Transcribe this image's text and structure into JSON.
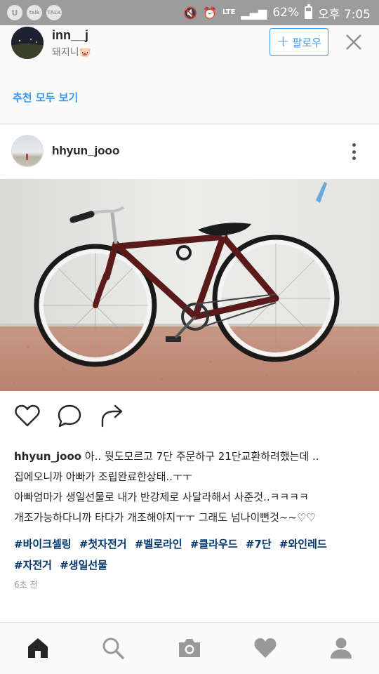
{
  "status_bar": {
    "app_icons": [
      "U",
      "talk",
      "TALK"
    ],
    "network": "LTE",
    "battery_text": "62%",
    "battery_level": 0.62,
    "time": "오후 7:05"
  },
  "suggestion": {
    "username": "inn__j",
    "subtitle": "돼지니🐷",
    "follow_label": "팔로우",
    "see_all_label": "추천 모두 보기"
  },
  "post": {
    "username": "hhyun_jooo",
    "caption": {
      "username": "hhyun_jooo",
      "line1": " 아.. 뭣도모르고 7단 주문하구 21단교환하려했는데 ..",
      "line2": "집에오니까 아빠가 조립완료한상태..ㅜㅜ",
      "line3": "아빠엄마가 생일선물로 내가 반강제로 사달라해서 사준것..ㅋㅋㅋㅋ",
      "line4": "개조가능하다니까 타다가 개조해야지ㅜㅜ 그래도 넘나이뻔것~~♡♡"
    },
    "hashtags": [
      "#바이크셀링",
      "#첫자전거",
      "#벨로라인",
      "#클라우드",
      "#7단",
      "#와인레드",
      "#자전거",
      "#생일선물"
    ],
    "timestamp": "6초 전"
  },
  "colors": {
    "accent": "#3897f0",
    "hashtag": "#003569",
    "status_bar": "#9c9c9c",
    "bike_frame": "#5a1a1a"
  },
  "icons": {
    "actions": [
      "heart-icon",
      "comment-icon",
      "share-icon"
    ],
    "nav": [
      "home-icon",
      "search-icon",
      "camera-icon",
      "heart-icon",
      "profile-icon"
    ]
  }
}
